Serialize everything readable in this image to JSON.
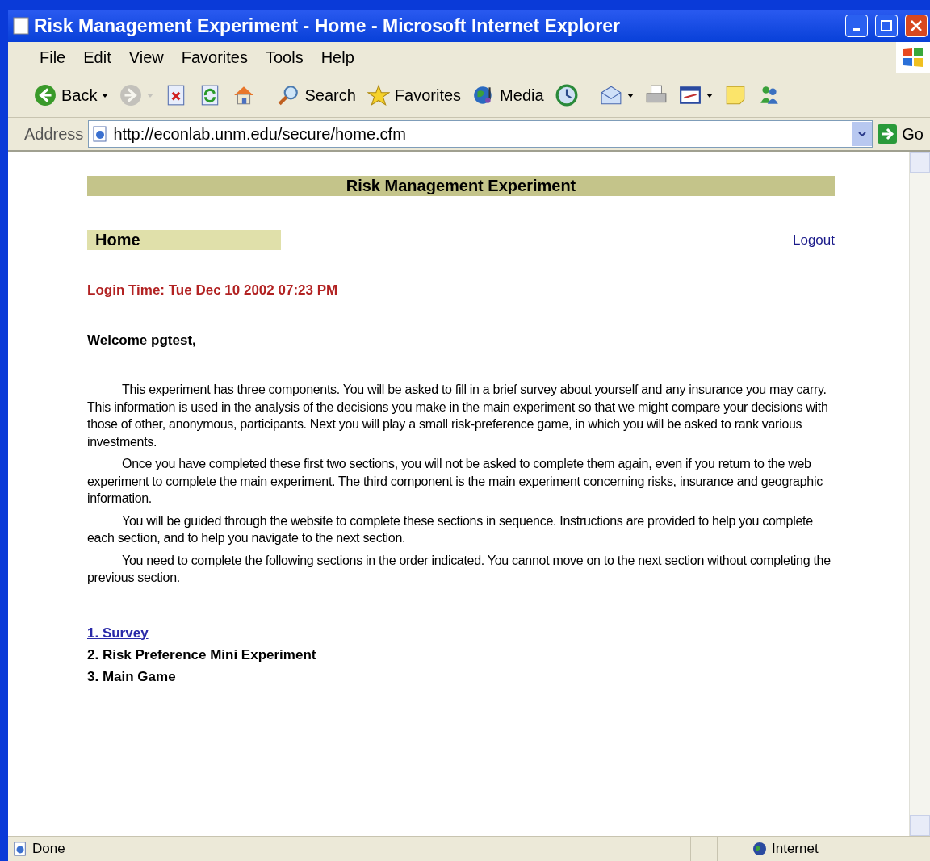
{
  "window": {
    "title": "Risk Management Experiment - Home - Microsoft Internet Explorer"
  },
  "menu": [
    {
      "label": "File"
    },
    {
      "label": "Edit"
    },
    {
      "label": "View"
    },
    {
      "label": "Favorites"
    },
    {
      "label": "Tools"
    },
    {
      "label": "Help"
    }
  ],
  "toolbar": [
    {
      "kind": "back",
      "label": "Back",
      "disabled": false
    },
    {
      "kind": "forward",
      "disabled": true
    },
    {
      "kind": "stop"
    },
    {
      "kind": "refresh"
    },
    {
      "kind": "home"
    },
    {
      "kind": "sep"
    },
    {
      "kind": "search",
      "label": "Search"
    },
    {
      "kind": "favorites",
      "label": "Favorites"
    },
    {
      "kind": "media",
      "label": "Media"
    },
    {
      "kind": "history"
    },
    {
      "kind": "sep"
    },
    {
      "kind": "mail"
    },
    {
      "kind": "print"
    },
    {
      "kind": "edit"
    },
    {
      "kind": "note"
    },
    {
      "kind": "messenger"
    }
  ],
  "address": {
    "label": "Address",
    "value": "http://econlab.unm.edu/secure/home.cfm",
    "go": "Go"
  },
  "page": {
    "banner": "Risk Management Experiment",
    "section": "Home",
    "logout": "Logout",
    "login_time": "Login Time: Tue Dec 10 2002 07:23 PM",
    "welcome": "Welcome pgtest,",
    "paragraphs": [
      "This experiment has three components. You will be asked to fill in a brief survey about yourself and any insurance you may carry. This information is used in the analysis of the decisions you make in the main experiment so that we might compare your decisions with those of other, anonymous, participants. Next you will play a small risk-preference game, in which you will be asked to rank various investments.",
      "Once you have completed these first two sections, you will not be asked to complete them again, even if you return to the web experiment to complete the main experiment. The third component is the main experiment concerning risks, insurance and geographic information.",
      "You will be guided through the website to complete these sections in sequence. Instructions are provided to help you complete each section, and to help you navigate to the next section.",
      "You need to complete the following sections in the order indicated. You cannot move on to the next section without completing the previous section."
    ],
    "sections": [
      {
        "label": "1. Survey",
        "kind": "link"
      },
      {
        "label": "2. Risk Preference Mini Experiment",
        "kind": "text"
      },
      {
        "label": "3. Main Game",
        "kind": "text"
      }
    ]
  },
  "status_bar": {
    "text": "Done",
    "zone": "Internet"
  }
}
